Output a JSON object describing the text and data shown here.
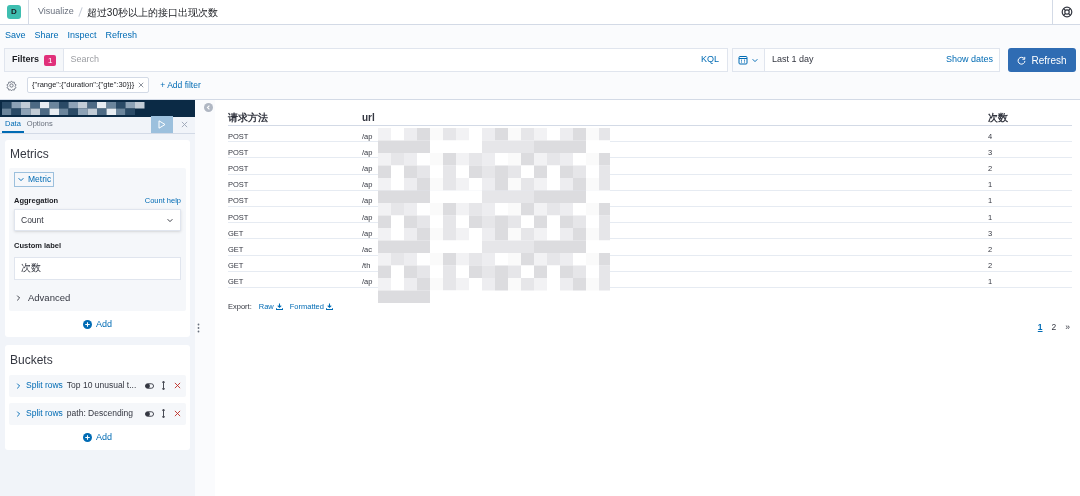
{
  "header": {
    "logo_letter": "D",
    "breadcrumbs": [
      "Visualize",
      "超过30秒以上的接口出现次数"
    ]
  },
  "top_nav": [
    "Save",
    "Share",
    "Inspect",
    "Refresh"
  ],
  "query_bar": {
    "filters_label": "Filters",
    "filter_count": "1",
    "search_placeholder": "Search",
    "language": "KQL",
    "time_range": "Last 1 day",
    "show_dates": "Show dates",
    "refresh_button": "Refresh"
  },
  "filter_pills": [
    {
      "label": "{\"range\":{\"duration\":{\"gte\":30}}}"
    }
  ],
  "add_filter": "+ Add filter",
  "sidebar": {
    "tabs": [
      {
        "label": "Data",
        "selected": true
      },
      {
        "label": "Options",
        "selected": false
      }
    ],
    "metrics": {
      "title": "Metrics",
      "metric_label": "Metric",
      "expanded": true,
      "aggregation_label": "Aggregation",
      "help_link": "Count help",
      "aggregation_value": "Count",
      "custom_label_label": "Custom label",
      "custom_label_value": "次数",
      "advanced": {
        "label": "Advanced",
        "expanded": false
      },
      "add": "Add"
    },
    "buckets": {
      "title": "Buckets",
      "items": [
        {
          "type_label": "Split rows",
          "description": "Top 10 unusual t...",
          "expanded": false
        },
        {
          "type_label": "Split rows",
          "description": "path: Descending",
          "expanded": false
        }
      ],
      "add": "Add"
    }
  },
  "table": {
    "columns": [
      "请求方法",
      "url",
      "次数"
    ],
    "rows": [
      [
        "POST",
        "/ap",
        "4"
      ],
      [
        "POST",
        "/ap",
        "3"
      ],
      [
        "POST",
        "/ap",
        "2"
      ],
      [
        "POST",
        "/ap",
        "1"
      ],
      [
        "POST",
        "/ap",
        "1"
      ],
      [
        "POST",
        "/ap",
        "1"
      ],
      [
        "GET",
        "/ap",
        "3"
      ],
      [
        "GET",
        "/ac",
        "2"
      ],
      [
        "GET",
        "/th",
        "2"
      ],
      [
        "GET",
        "/ap",
        "1"
      ]
    ],
    "export_label": "Export:",
    "export_links": [
      "Raw",
      "Formatted"
    ],
    "pagination": [
      {
        "label": "1",
        "selected": true
      },
      {
        "label": "2",
        "selected": false
      }
    ],
    "next": "»"
  }
}
